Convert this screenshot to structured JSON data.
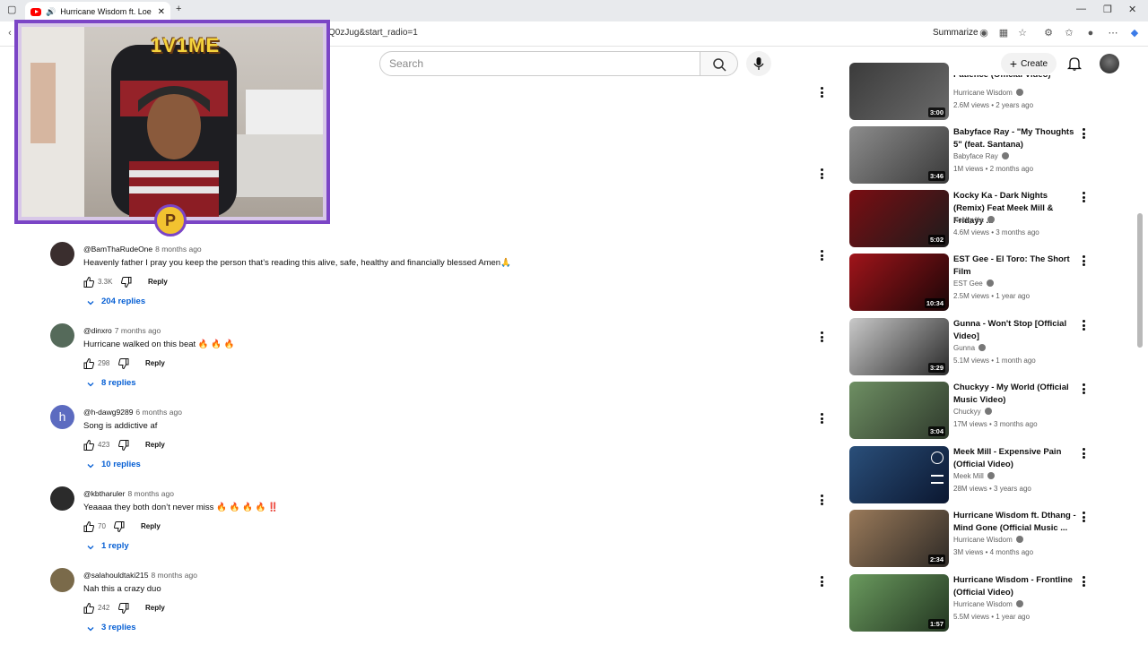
{
  "browser": {
    "tab_title": "Hurricane Wisdom ft. Loe Sh",
    "url_fragment": "Q0zJug&start_radio=1",
    "summarize_label": "Summarize"
  },
  "header": {
    "search_placeholder": "Search",
    "create_label": "Create"
  },
  "overlay": {
    "logo_text": "1V1ME",
    "badge_letter": "P"
  },
  "comments": [
    {
      "author": "@BamThaRudeOne",
      "time": "8 months ago",
      "text": "Heavenly father I pray you keep the person that’s reading this alive, safe, healthy and financially blessed Amen🙏",
      "likes": "3.3K",
      "reply_label": "Reply",
      "replies": "204 replies",
      "avatar_color": "#3a2e2e"
    },
    {
      "author": "@dinxro",
      "time": "7 months ago",
      "text": "Hurricane walked on this beat 🔥 🔥 🔥",
      "likes": "298",
      "reply_label": "Reply",
      "replies": "8 replies",
      "avatar_color": "#556a5a"
    },
    {
      "author": "@h-dawg9289",
      "time": "6 months ago",
      "text": "Song is addictive af",
      "likes": "423",
      "reply_label": "Reply",
      "replies": "10 replies",
      "avatar_letter": "h",
      "avatar_color": "#5c6bc0"
    },
    {
      "author": "@kbtharuler",
      "time": "8 months ago",
      "text": "Yeaaaa they both don’t never miss 🔥 🔥 🔥 🔥 ‼️",
      "likes": "70",
      "reply_label": "Reply",
      "replies": "1 reply",
      "avatar_color": "#2b2b2b"
    },
    {
      "author": "@salahouldtaki215",
      "time": "8 months ago",
      "text": "Nah this a crazy duo",
      "likes": "242",
      "reply_label": "Reply",
      "replies": "3 replies",
      "avatar_color": "#7a6a4a"
    }
  ],
  "sidebar": [
    {
      "title": "Patience (Official Video)",
      "channel": "Hurricane Wisdom",
      "verified": true,
      "meta": "2.6M views • 2 years ago",
      "duration": "3:00",
      "thumb": [
        "#3b3b3b",
        "#6a6a6a"
      ]
    },
    {
      "title": "Babyface Ray - \"My Thoughts 5\" (feat. Santana)",
      "channel": "Babyface Ray",
      "verified": true,
      "meta": "1M views • 2 months ago",
      "duration": "3:46",
      "thumb": [
        "#8c8c8c",
        "#3a3a3a"
      ]
    },
    {
      "title": "Kocky Ka - Dark Nights (Remix) Feat Meek Mill & Fridayy ...",
      "channel": "Kocky Ka",
      "verified": true,
      "meta": "4.6M views • 3 months ago",
      "duration": "5:02",
      "thumb": [
        "#7a0d12",
        "#1c1c1c"
      ]
    },
    {
      "title": "EST Gee - El Toro: The Short Film",
      "channel": "EST Gee",
      "verified": true,
      "meta": "2.5M views • 1 year ago",
      "duration": "10:34",
      "thumb": [
        "#a0141a",
        "#1a0607"
      ]
    },
    {
      "title": "Gunna - Won't Stop [Official Video]",
      "channel": "Gunna",
      "verified": true,
      "meta": "5.1M views • 1 month ago",
      "duration": "3:29",
      "thumb": [
        "#c9c9c9",
        "#2a2a2a"
      ]
    },
    {
      "title": "Chuckyy - My World (Official Music Video)",
      "channel": "Chuckyy",
      "verified": true,
      "meta": "17M views • 3 months ago",
      "duration": "3:04",
      "thumb": [
        "#6e8f63",
        "#2f3a2c"
      ]
    },
    {
      "title": "Meek Mill - Expensive Pain (Official Video)",
      "channel": "Meek Mill",
      "verified": true,
      "meta": "28M views • 3 years ago",
      "duration": "",
      "thumb": [
        "#2a4f7a",
        "#0b1730"
      ]
    },
    {
      "title": "Hurricane Wisdom ft. Dthang - Mind Gone (Official Music ...",
      "channel": "Hurricane Wisdom",
      "verified": true,
      "meta": "3M views • 4 months ago",
      "duration": "2:34",
      "thumb": [
        "#9a7a5a",
        "#2e2a26"
      ]
    },
    {
      "title": "Hurricane Wisdom - Frontline (Official Video)",
      "channel": "Hurricane Wisdom",
      "verified": true,
      "meta": "5.5M views • 1 year ago",
      "duration": "1:57",
      "thumb": [
        "#6a9a5e",
        "#233621"
      ]
    }
  ]
}
